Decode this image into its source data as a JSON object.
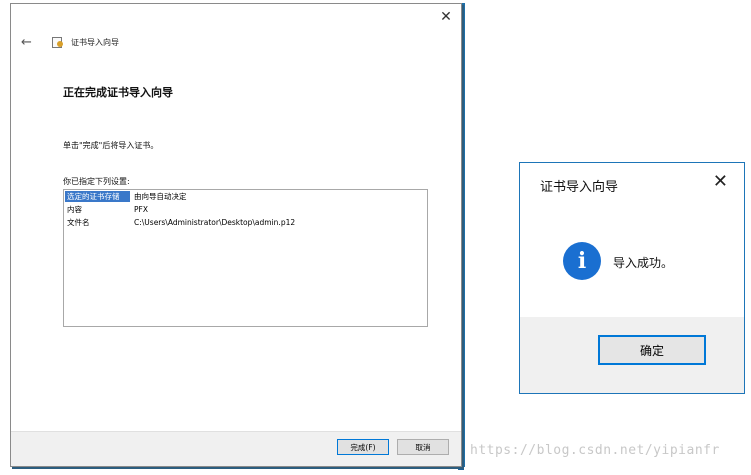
{
  "wizard": {
    "close_glyph": "✕",
    "back_glyph": "←",
    "title": "证书导入向导",
    "heading": "正在完成证书导入向导",
    "description": "单击\"完成\"后将导入证书。",
    "settings_label": "你已指定下列设置:",
    "settings": [
      {
        "name": "选定的证书存储",
        "value": "由向导自动决定"
      },
      {
        "name": "内容",
        "value": "PFX"
      },
      {
        "name": "文件名",
        "value": "C:\\Users\\Administrator\\Desktop\\admin.p12"
      }
    ],
    "finish_label": "完成(F)",
    "cancel_label": "取消"
  },
  "dialog": {
    "title": "证书导入向导",
    "close_glyph": "✕",
    "info_glyph": "i",
    "message": "导入成功。",
    "ok_label": "确定"
  },
  "watermark": "https://blog.csdn.net/yipianfr",
  "colors": {
    "accent": "#0078d7",
    "selection": "#3a78c9",
    "info_icon": "#1a6fd1"
  }
}
